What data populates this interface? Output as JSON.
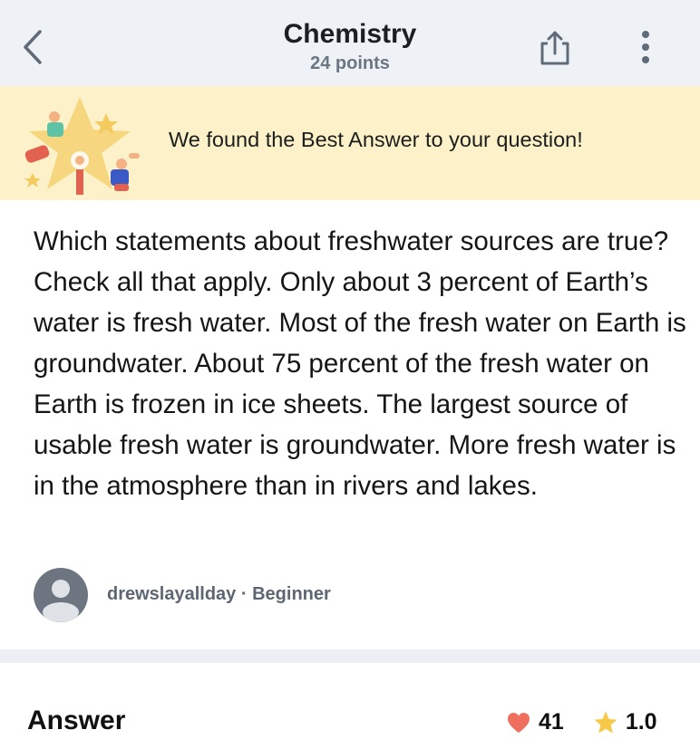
{
  "header": {
    "title": "Chemistry",
    "subtitle": "24 points",
    "back_icon": "back-chevron-icon",
    "share_icon": "share-icon",
    "more_icon": "more-vertical-icon"
  },
  "banner": {
    "message": "We found the Best Answer to your question!",
    "illustration": "star-with-people-illustration",
    "background": "#fcf1c8"
  },
  "question": {
    "text": "Which statements about freshwater sources are true? Check all that apply. Only about 3 percent of Earth’s water is fresh water. Most of the fresh water on Earth is groundwater. About 75 percent of the fresh water on Earth is frozen in ice sheets. The largest source of usable fresh water is groundwater. More fresh water is in the atmosphere than in rivers and lakes.",
    "author": {
      "name": "drewslayallday",
      "separator": "·",
      "rank": "Beginner"
    }
  },
  "answer": {
    "heading": "Answer",
    "likes": "41",
    "rating": "1.0",
    "heart_color": "#ef6f5e",
    "star_color": "#f7c948"
  }
}
